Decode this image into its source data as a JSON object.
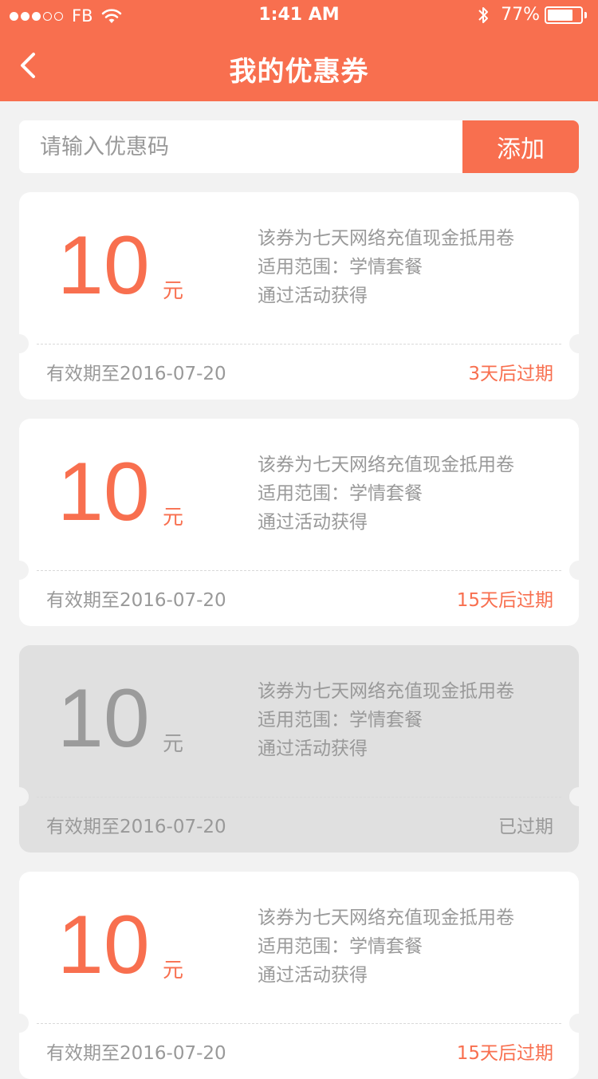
{
  "status_bar": {
    "carrier": "FB",
    "time": "1:41 AM",
    "battery": "77%",
    "battery_level": 0.77,
    "signal_bars_filled": 3,
    "signal_bars_total": 5
  },
  "nav": {
    "title": "我的优惠券",
    "back_icon": "chevron-left-icon"
  },
  "code_entry": {
    "placeholder": "请输入优惠码",
    "value": "",
    "button_label": "添加"
  },
  "colors": {
    "accent": "#f86f4f",
    "background": "#f2f2f2",
    "expired_card": "#e0e0e0"
  },
  "coupons": [
    {
      "amount": "10",
      "unit": "元",
      "desc_line1": "该券为七天网络充值现金抵用卷",
      "desc_line2": "适用范围：学情套餐",
      "desc_line3": "通过活动获得",
      "validity": "有效期至2016-07-20",
      "status": "3天后过期",
      "expired": false
    },
    {
      "amount": "10",
      "unit": "元",
      "desc_line1": "该券为七天网络充值现金抵用卷",
      "desc_line2": "适用范围：学情套餐",
      "desc_line3": "通过活动获得",
      "validity": "有效期至2016-07-20",
      "status": "15天后过期",
      "expired": false
    },
    {
      "amount": "10",
      "unit": "元",
      "desc_line1": "该券为七天网络充值现金抵用卷",
      "desc_line2": "适用范围：学情套餐",
      "desc_line3": "通过活动获得",
      "validity": "有效期至2016-07-20",
      "status": "已过期",
      "expired": true
    },
    {
      "amount": "10",
      "unit": "元",
      "desc_line1": "该券为七天网络充值现金抵用卷",
      "desc_line2": "适用范围：学情套餐",
      "desc_line3": "通过活动获得",
      "validity": "有效期至2016-07-20",
      "status": "15天后过期",
      "expired": false
    }
  ]
}
